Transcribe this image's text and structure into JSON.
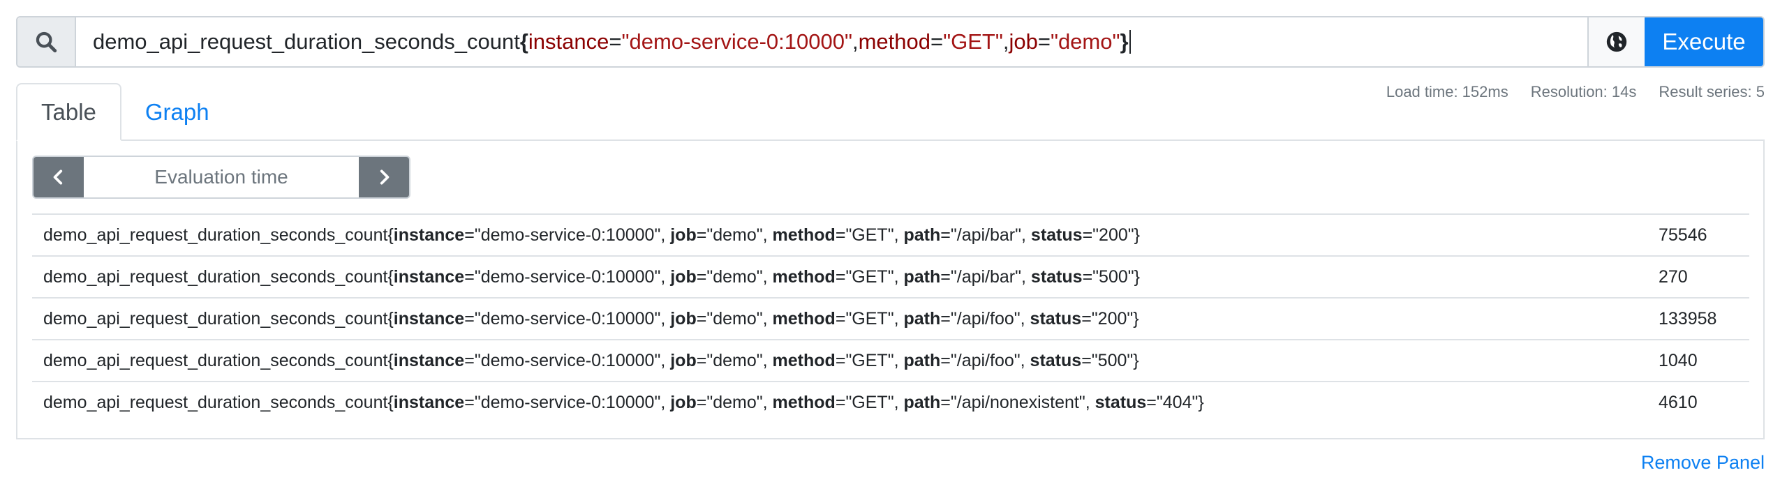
{
  "query": {
    "metric": "demo_api_request_duration_seconds_count",
    "matchers": [
      {
        "label": "instance",
        "value": "\"demo-service-0:10000\""
      },
      {
        "label": "method",
        "value": "\"GET\""
      },
      {
        "label": "job",
        "value": "\"demo\""
      }
    ],
    "open_brace": "{",
    "close_brace": "}",
    "equals": "=",
    "comma": ","
  },
  "toolbar": {
    "search_icon": "search-icon",
    "explorer_icon": "globe-icon",
    "execute_label": "Execute"
  },
  "tabs": [
    {
      "label": "Table",
      "active": true
    },
    {
      "label": "Graph",
      "active": false
    }
  ],
  "stats": {
    "load_time": "Load time: 152ms",
    "resolution": "Resolution: 14s",
    "result_series": "Result series: 5"
  },
  "evaluation": {
    "placeholder": "Evaluation time",
    "prev_icon": "chevron-left-icon",
    "next_icon": "chevron-right-icon"
  },
  "results": [
    {
      "metric": "demo_api_request_duration_seconds_count",
      "labels": [
        {
          "name": "instance",
          "value": "\"demo-service-0:10000\""
        },
        {
          "name": "job",
          "value": "\"demo\""
        },
        {
          "name": "method",
          "value": "\"GET\""
        },
        {
          "name": "path",
          "value": "\"/api/bar\""
        },
        {
          "name": "status",
          "value": "\"200\""
        }
      ],
      "value": "75546"
    },
    {
      "metric": "demo_api_request_duration_seconds_count",
      "labels": [
        {
          "name": "instance",
          "value": "\"demo-service-0:10000\""
        },
        {
          "name": "job",
          "value": "\"demo\""
        },
        {
          "name": "method",
          "value": "\"GET\""
        },
        {
          "name": "path",
          "value": "\"/api/bar\""
        },
        {
          "name": "status",
          "value": "\"500\""
        }
      ],
      "value": "270"
    },
    {
      "metric": "demo_api_request_duration_seconds_count",
      "labels": [
        {
          "name": "instance",
          "value": "\"demo-service-0:10000\""
        },
        {
          "name": "job",
          "value": "\"demo\""
        },
        {
          "name": "method",
          "value": "\"GET\""
        },
        {
          "name": "path",
          "value": "\"/api/foo\""
        },
        {
          "name": "status",
          "value": "\"200\""
        }
      ],
      "value": "133958"
    },
    {
      "metric": "demo_api_request_duration_seconds_count",
      "labels": [
        {
          "name": "instance",
          "value": "\"demo-service-0:10000\""
        },
        {
          "name": "job",
          "value": "\"demo\""
        },
        {
          "name": "method",
          "value": "\"GET\""
        },
        {
          "name": "path",
          "value": "\"/api/foo\""
        },
        {
          "name": "status",
          "value": "\"500\""
        }
      ],
      "value": "1040"
    },
    {
      "metric": "demo_api_request_duration_seconds_count",
      "labels": [
        {
          "name": "instance",
          "value": "\"demo-service-0:10000\""
        },
        {
          "name": "job",
          "value": "\"demo\""
        },
        {
          "name": "method",
          "value": "\"GET\""
        },
        {
          "name": "path",
          "value": "\"/api/nonexistent\""
        },
        {
          "name": "status",
          "value": "\"404\""
        }
      ],
      "value": "4610"
    }
  ],
  "panel": {
    "remove_label": "Remove Panel"
  },
  "colors": {
    "primary": "#0d80f2",
    "secondary": "#6c757d",
    "label_key": "#8b0000",
    "label_value": "#a31515"
  }
}
